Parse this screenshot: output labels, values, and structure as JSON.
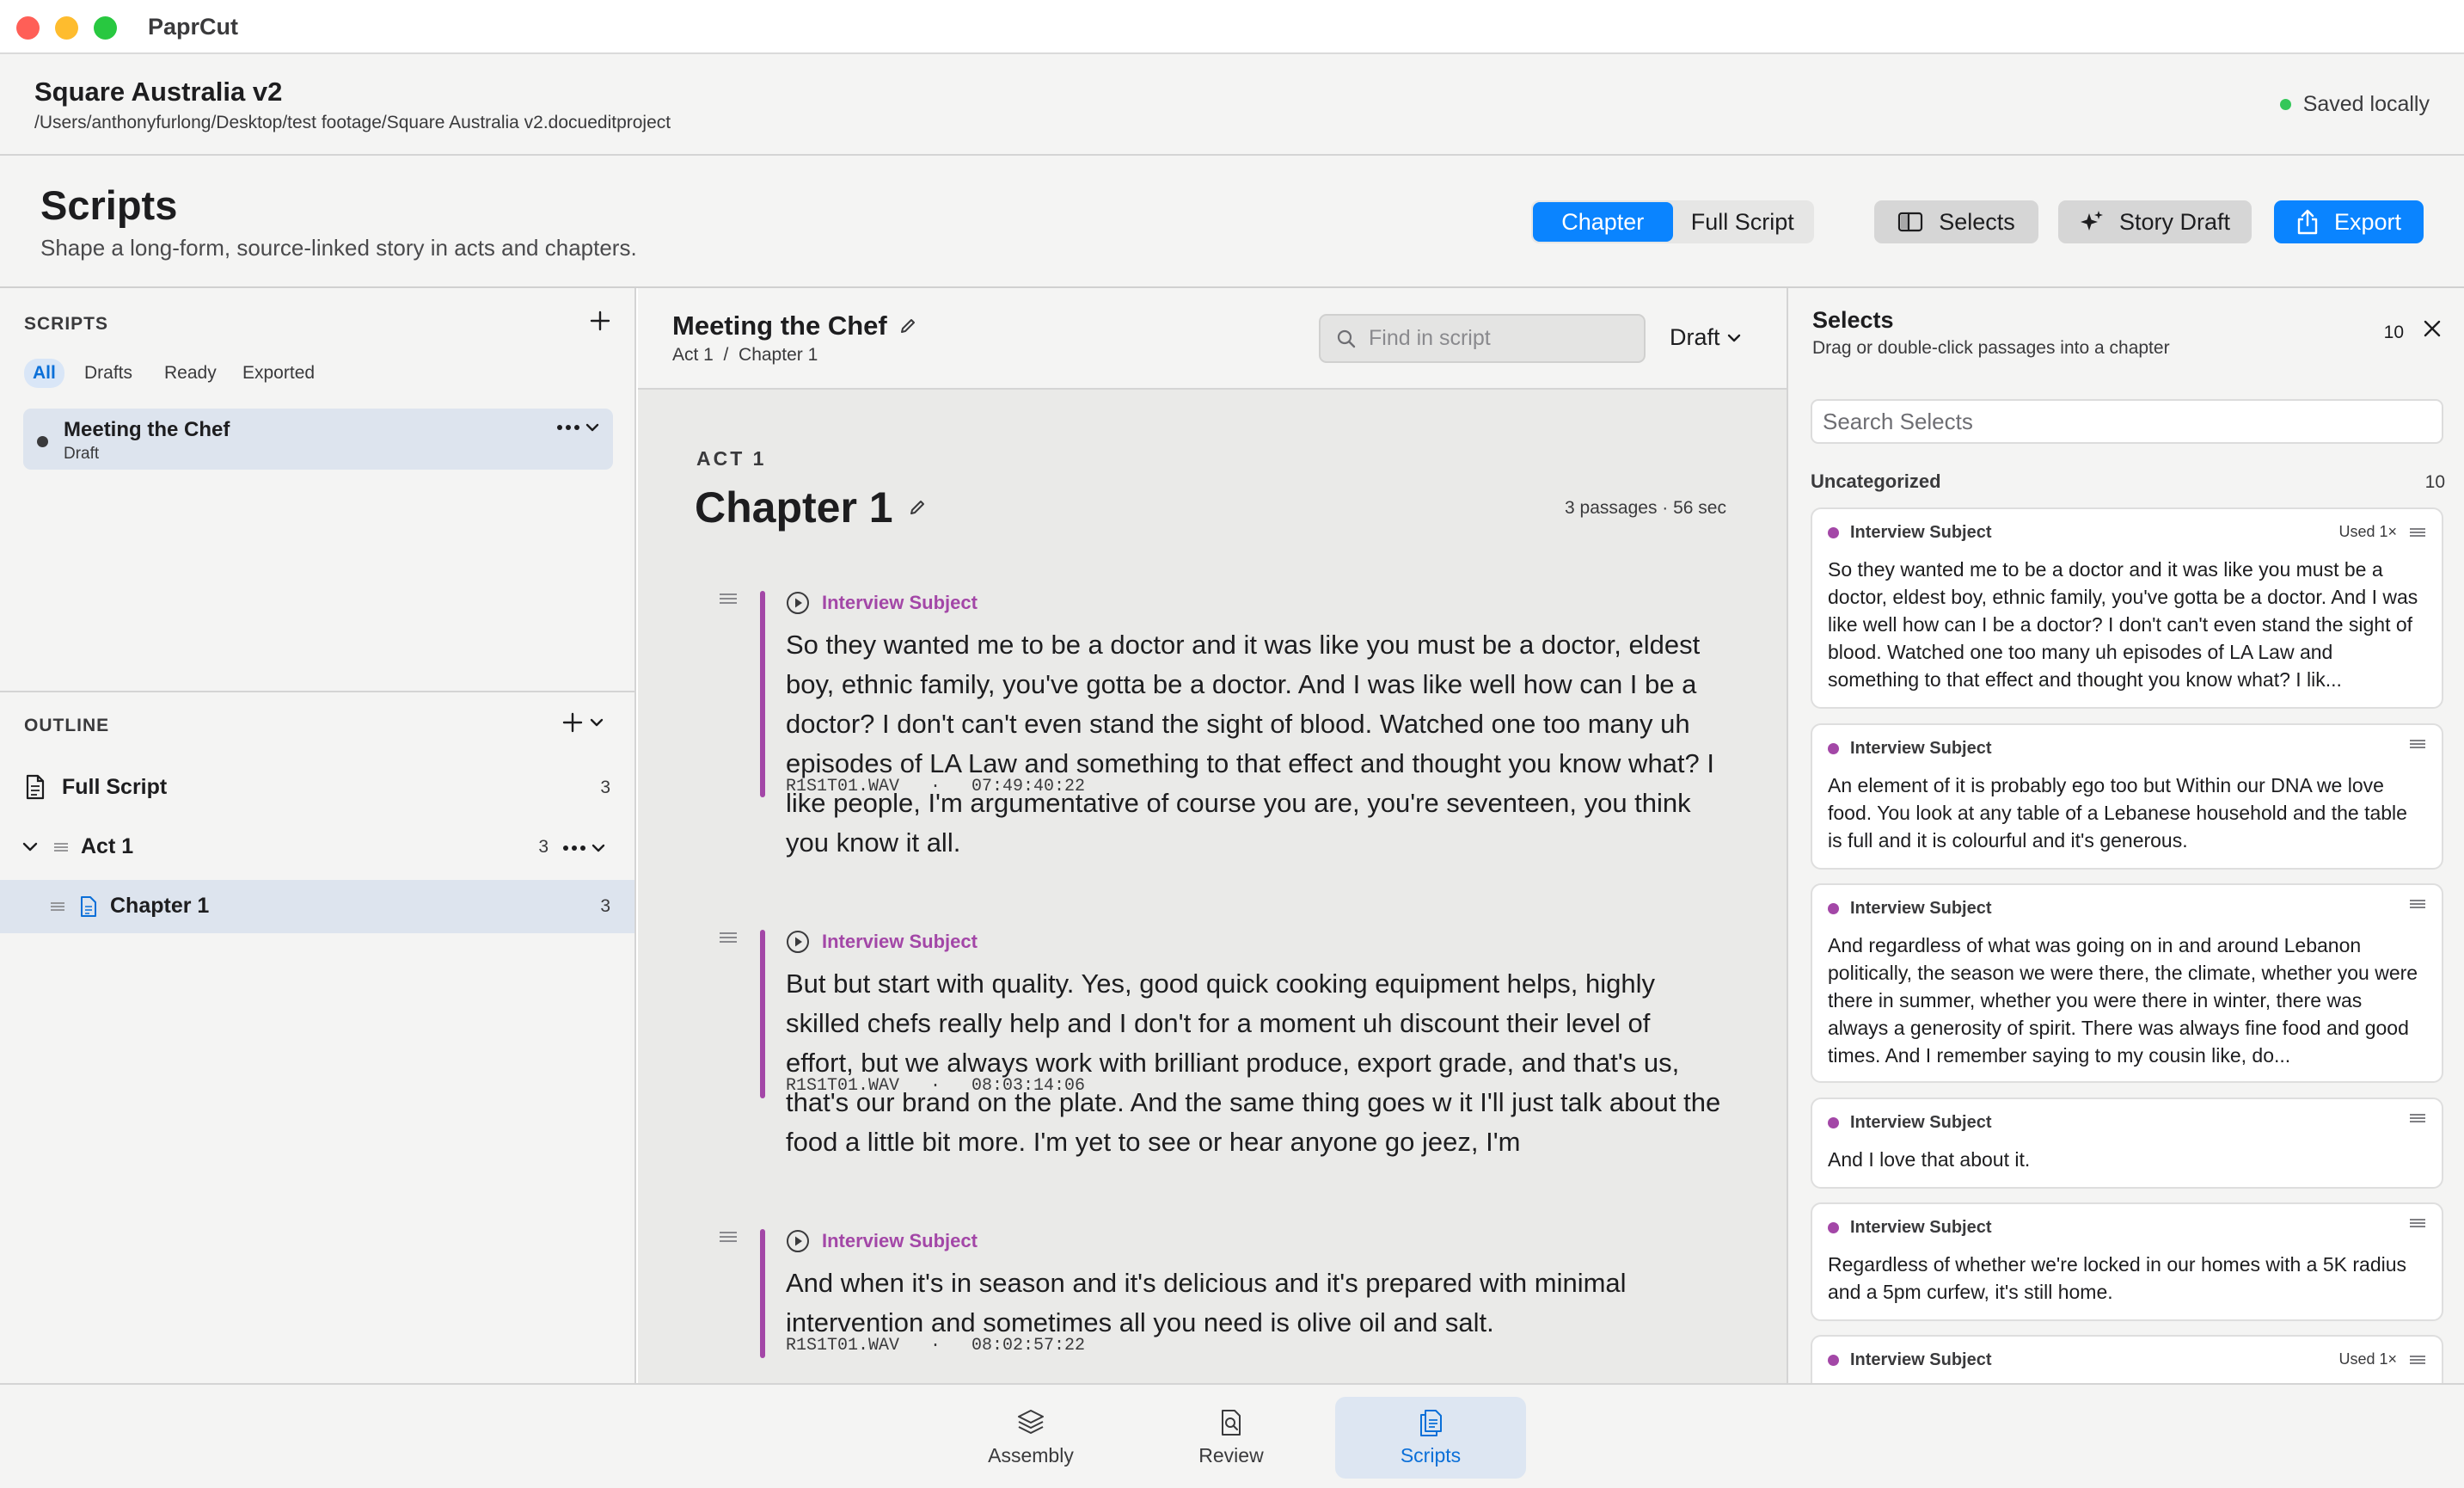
{
  "app": {
    "name": "PaprCut"
  },
  "project": {
    "title": "Square Australia v2",
    "path": "/Users/anthonyfurlong/Desktop/test footage/Square Australia v2.docueditproject",
    "save_status": "Saved locally"
  },
  "page": {
    "title": "Scripts",
    "subtitle": "Shape a long-form, source-linked story in acts and chapters."
  },
  "view_toggle": {
    "chapter": "Chapter",
    "full_script": "Full Script",
    "selected": "Chapter"
  },
  "toolbar": {
    "selects": "Selects",
    "story_draft": "Story Draft",
    "export": "Export"
  },
  "colors": {
    "accent": "#0a84ff",
    "speaker": "#a347a7",
    "saved_dot": "#34c759"
  },
  "sidebar": {
    "scripts_label": "SCRIPTS",
    "filters": [
      "All",
      "Drafts",
      "Ready",
      "Exported"
    ],
    "active_filter": "All",
    "scripts": [
      {
        "name": "Meeting the Chef",
        "status": "Draft"
      }
    ],
    "outline_label": "OUTLINE",
    "outline": {
      "full_script": {
        "label": "Full Script",
        "count": "3"
      },
      "act": {
        "label": "Act 1",
        "count": "3"
      },
      "chapter": {
        "label": "Chapter 1",
        "count": "3"
      }
    }
  },
  "editor": {
    "title": "Meeting the Chef",
    "breadcrumb": "Act 1  /  Chapter 1",
    "find_placeholder": "Find in script",
    "status_dropdown": "Draft",
    "act_label": "ACT 1",
    "chapter_title": "Chapter 1",
    "chapter_meta": "3 passages · 56 sec",
    "passages": [
      {
        "speaker": "Interview Subject",
        "text": "So they wanted me to be a doctor and it was like you must be a doctor, eldest boy, ethnic family, you've gotta be a doctor. And I was like well how can I be a doctor? I don't can't even stand the sight of blood. Watched one too many uh episodes of LA Law and something to that effect and thought you know what? I like people, I'm argumentative of course you are, you're seventeen, you think you know it all.",
        "source": "R1S1T01.WAV   ·   07:49:40:22"
      },
      {
        "speaker": "Interview Subject",
        "text": "But but start with quality. Yes, good quick cooking equipment helps, highly skilled chefs really help and I don't for a moment uh discount their level of effort, but we always work with brilliant produce, export grade, and that's us, that's our brand on the plate. And the same thing goes w it I'll just talk about the food a little bit more. I'm yet to see or hear anyone go jeez, I'm",
        "source": "R1S1T01.WAV   ·   08:03:14:06"
      },
      {
        "speaker": "Interview Subject",
        "text": "And when it's in season and it's delicious and it's prepared with minimal intervention and sometimes all you need is olive oil and salt.",
        "source": "R1S1T01.WAV   ·   08:02:57:22"
      }
    ]
  },
  "selects": {
    "title": "Selects",
    "subtitle": "Drag or double-click passages into a chapter",
    "count": "10",
    "search_placeholder": "Search Selects",
    "group": {
      "name": "Uncategorized",
      "count": "10"
    },
    "cards": [
      {
        "speaker": "Interview Subject",
        "used": "Used 1×",
        "text": "So they wanted me to be a doctor and it was like you must be a doctor, eldest boy, ethnic family, you've gotta be a doctor. And I was like well how can I be a doctor? I don't can't even stand the sight of blood. Watched one too many uh episodes of LA Law and something to that effect and thought you know what? I lik..."
      },
      {
        "speaker": "Interview Subject",
        "used": "",
        "text": "An element of it is probably ego too but Within our DNA we love food. You look at any table of a Lebanese household and the table is full and it is colourful and it's generous."
      },
      {
        "speaker": "Interview Subject",
        "used": "",
        "text": "And regardless of what was going on in and around Lebanon politically, the season we were there, the climate, whether you were there in summer, whether you were there in winter, there was always a generosity of spirit. There was always fine food and good times. And I remember saying to my cousin like, do..."
      },
      {
        "speaker": "Interview Subject",
        "used": "",
        "text": "And I love that about it."
      },
      {
        "speaker": "Interview Subject",
        "used": "",
        "text": "Regardless of whether we're locked in our homes with a 5K radius and a 5pm curfew, it's still home."
      },
      {
        "speaker": "Interview Subject",
        "used": "Used 1×",
        "text": ""
      }
    ]
  },
  "bottom_tabs": {
    "assembly": "Assembly",
    "review": "Review",
    "scripts": "Scripts",
    "active": "Scripts"
  }
}
